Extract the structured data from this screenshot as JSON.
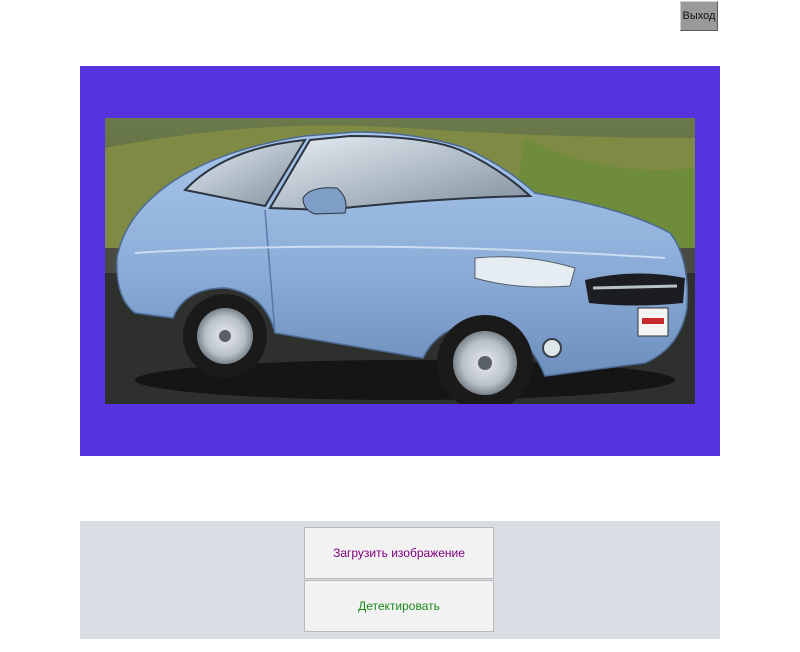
{
  "header": {
    "exit_label": "Выход"
  },
  "image_panel": {
    "background_color": "#5533e0",
    "image_subject": "light blue sedan car photo"
  },
  "controls": {
    "upload_label": "Загрузить изображение",
    "upload_color": "#800080",
    "detect_label": "Детектировать",
    "detect_color": "#1a8a1a"
  }
}
